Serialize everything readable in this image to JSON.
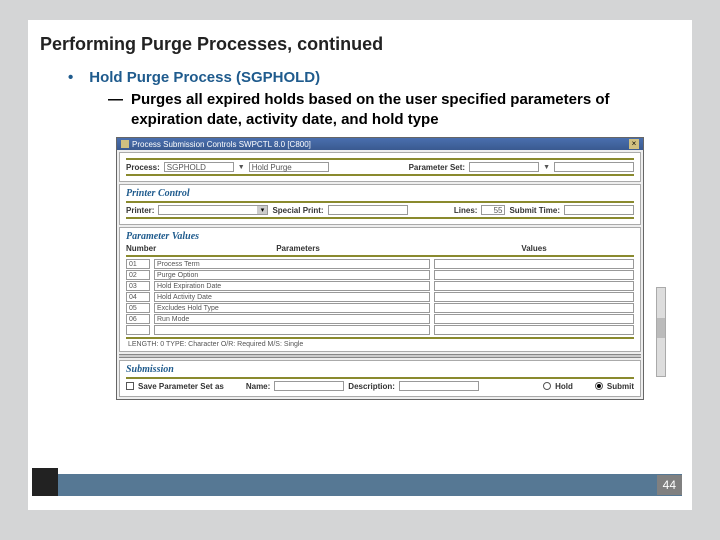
{
  "slide": {
    "title": "Performing Purge Processes, continued",
    "bullet": "Hold Purge Process (SGPHOLD)",
    "dash": "Purges all expired holds based on the user specified parameters of expiration date, activity date, and hold type",
    "page_number": "44"
  },
  "app": {
    "window_title": "Process Submission Controls  SWPCTL  8.0  [C800]",
    "process_label": "Process:",
    "process_value": "SGPHOLD",
    "process_desc": "Hold Purge",
    "paramset_label": "Parameter Set:",
    "printer_section": "Printer Control",
    "printer_label": "Printer:",
    "special_print_label": "Special Print:",
    "lines_label": "Lines:",
    "lines_value": "55",
    "submit_time_label": "Submit Time:",
    "param_section": "Parameter Values",
    "col_number": "Number",
    "col_parameters": "Parameters",
    "col_values": "Values",
    "params": [
      {
        "n": "01",
        "name": "Process Term"
      },
      {
        "n": "02",
        "name": "Purge Option"
      },
      {
        "n": "03",
        "name": "Hold Expiration Date"
      },
      {
        "n": "04",
        "name": "Hold Activity Date"
      },
      {
        "n": "05",
        "name": "Excludes Hold Type"
      },
      {
        "n": "06",
        "name": "Run Mode"
      }
    ],
    "length_line": "LENGTH: 0 TYPE: Character O/R: Required M/S: Single",
    "submission_section": "Submission",
    "save_param_label": "Save Parameter Set as",
    "name_label": "Name:",
    "desc_label": "Description:",
    "hold_label": "Hold",
    "submit_label": "Submit"
  }
}
